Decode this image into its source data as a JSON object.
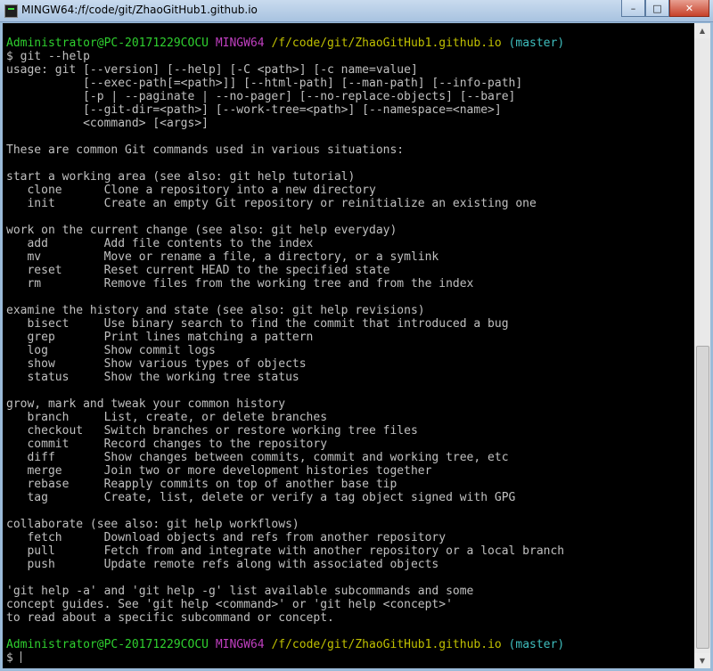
{
  "window": {
    "title": "MINGW64:/f/code/git/ZhaoGitHub1.github.io",
    "app_icon": "terminal-icon",
    "controls": {
      "minimize": "–",
      "maximize": "□",
      "close": "✕"
    }
  },
  "prompt": {
    "user_host": "Administrator@PC-20171229COCU",
    "env": "MINGW64",
    "path": "/f/code/git/ZhaoGitHub1.github.io",
    "branch": "(master)"
  },
  "colors": {
    "background": "#000000",
    "text": "#c0c0c0",
    "prompt_user": "#2fd02f",
    "prompt_env": "#bf3fbf",
    "prompt_path": "#c0c000",
    "prompt_branch": "#3fbfbf"
  },
  "output": [
    "$ git --help",
    "usage: git [--version] [--help] [-C <path>] [-c name=value]",
    "           [--exec-path[=<path>]] [--html-path] [--man-path] [--info-path]",
    "           [-p | --paginate | --no-pager] [--no-replace-objects] [--bare]",
    "           [--git-dir=<path>] [--work-tree=<path>] [--namespace=<name>]",
    "           <command> [<args>]",
    "",
    "These are common Git commands used in various situations:",
    "",
    "start a working area (see also: git help tutorial)",
    "   clone      Clone a repository into a new directory",
    "   init       Create an empty Git repository or reinitialize an existing one",
    "",
    "work on the current change (see also: git help everyday)",
    "   add        Add file contents to the index",
    "   mv         Move or rename a file, a directory, or a symlink",
    "   reset      Reset current HEAD to the specified state",
    "   rm         Remove files from the working tree and from the index",
    "",
    "examine the history and state (see also: git help revisions)",
    "   bisect     Use binary search to find the commit that introduced a bug",
    "   grep       Print lines matching a pattern",
    "   log        Show commit logs",
    "   show       Show various types of objects",
    "   status     Show the working tree status",
    "",
    "grow, mark and tweak your common history",
    "   branch     List, create, or delete branches",
    "   checkout   Switch branches or restore working tree files",
    "   commit     Record changes to the repository",
    "   diff       Show changes between commits, commit and working tree, etc",
    "   merge      Join two or more development histories together",
    "   rebase     Reapply commits on top of another base tip",
    "   tag        Create, list, delete or verify a tag object signed with GPG",
    "",
    "collaborate (see also: git help workflows)",
    "   fetch      Download objects and refs from another repository",
    "   pull       Fetch from and integrate with another repository or a local branch",
    "   push       Update remote refs along with associated objects",
    "",
    "'git help -a' and 'git help -g' list available subcommands and some",
    "concept guides. See 'git help <command>' or 'git help <concept>'",
    "to read about a specific subcommand or concept.",
    ""
  ],
  "final_prompt_symbol": "$"
}
